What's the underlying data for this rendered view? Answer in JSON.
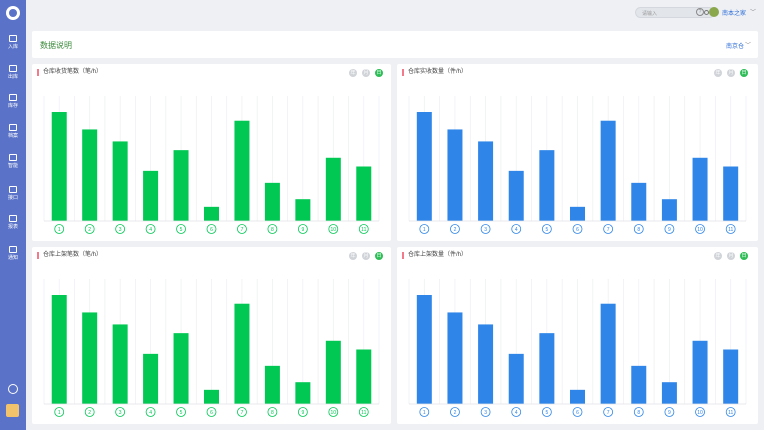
{
  "sidebar": {
    "items": [
      {
        "label": "入库",
        "icon": "inbound-icon"
      },
      {
        "label": "出库",
        "icon": "outbound-icon"
      },
      {
        "label": "库存",
        "icon": "inventory-icon"
      },
      {
        "label": "档案",
        "icon": "archive-icon"
      },
      {
        "label": "智能",
        "icon": "smart-icon"
      },
      {
        "label": "接口",
        "icon": "api-icon"
      },
      {
        "label": "报表",
        "icon": "report-icon"
      },
      {
        "label": "通知",
        "icon": "notification-icon"
      }
    ]
  },
  "topbar": {
    "search_placeholder": "请输入",
    "help": "?",
    "user_name": "南本之家",
    "chev": "﹀"
  },
  "header": {
    "title": "数据说明",
    "selector": "南京仓",
    "chev": "﹀"
  },
  "panels": [
    {
      "title": "仓库收货笔数（笔/h）",
      "toggles": [
        "年",
        "月",
        "日"
      ],
      "color": "#00c853"
    },
    {
      "title": "仓库实收数量（件/h）",
      "toggles": [
        "年",
        "月",
        "日"
      ],
      "color": "#2f86e8"
    },
    {
      "title": "仓库上架笔数（笔/h）",
      "toggles": [
        "年",
        "月",
        "日"
      ],
      "color": "#00c853"
    },
    {
      "title": "仓库上架数量（件/h）",
      "toggles": [
        "年",
        "月",
        "日"
      ],
      "color": "#2f86e8"
    }
  ],
  "chart_data": [
    {
      "type": "bar",
      "categories": [
        "1",
        "2",
        "3",
        "4",
        "5",
        "6",
        "7",
        "8",
        "9",
        "10",
        "11"
      ],
      "values": [
        100,
        84,
        73,
        46,
        65,
        13,
        92,
        35,
        20,
        58,
        50
      ],
      "title": "仓库收货笔数（笔/h）"
    },
    {
      "type": "bar",
      "categories": [
        "1",
        "2",
        "3",
        "4",
        "5",
        "6",
        "7",
        "8",
        "9",
        "10",
        "11"
      ],
      "values": [
        100,
        84,
        73,
        46,
        65,
        13,
        92,
        35,
        20,
        58,
        50
      ],
      "title": "仓库实收数量（件/h）"
    },
    {
      "type": "bar",
      "categories": [
        "1",
        "2",
        "3",
        "4",
        "5",
        "6",
        "7",
        "8",
        "9",
        "10",
        "11"
      ],
      "values": [
        100,
        84,
        73,
        46,
        65,
        13,
        92,
        35,
        20,
        58,
        50
      ],
      "title": "仓库上架笔数（笔/h）"
    },
    {
      "type": "bar",
      "categories": [
        "1",
        "2",
        "3",
        "4",
        "5",
        "6",
        "7",
        "8",
        "9",
        "10",
        "11"
      ],
      "values": [
        100,
        84,
        73,
        46,
        65,
        13,
        92,
        35,
        20,
        58,
        50
      ],
      "title": "仓库上架数量（件/h）"
    }
  ]
}
